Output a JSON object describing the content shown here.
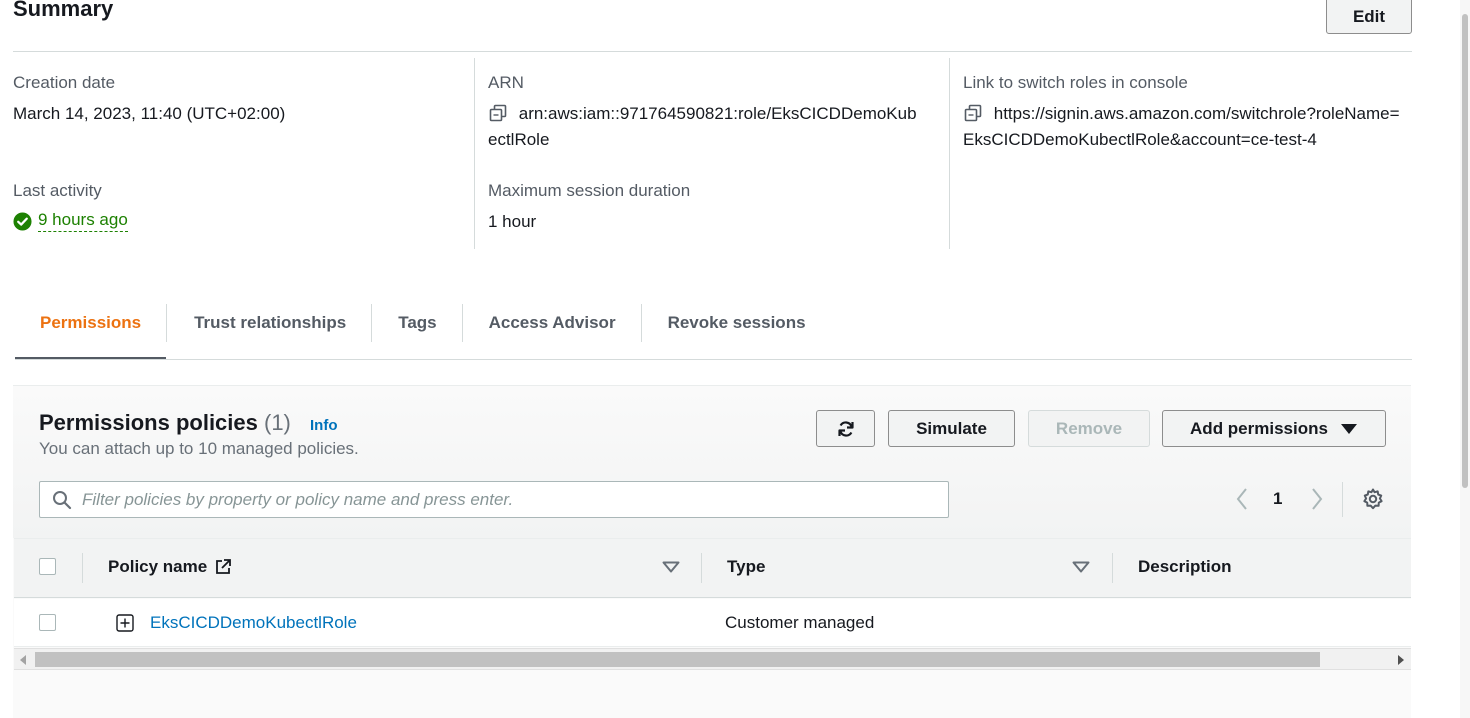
{
  "summary": {
    "title": "Summary",
    "edit_label": "Edit",
    "creation_date_label": "Creation date",
    "creation_date_value": "March 14, 2023, 11:40 (UTC+02:00)",
    "last_activity_label": "Last activity",
    "last_activity_value": "9 hours ago",
    "arn_label": "ARN",
    "arn_line1": "arn:aws:iam::971764590821:role/EksCICDDemoKub",
    "arn_line2": "ectlRole",
    "max_session_label": "Maximum session duration",
    "max_session_value": "1 hour",
    "switch_link_label": "Link to switch roles in console",
    "switch_link_line1": "https://signin.aws.amazon.com/switchrole?roleName=",
    "switch_link_line2": "EksCICDDemoKubectlRole&account=ce-test-4"
  },
  "tabs": [
    {
      "label": "Permissions",
      "active": true
    },
    {
      "label": "Trust relationships"
    },
    {
      "label": "Tags"
    },
    {
      "label": "Access Advisor"
    },
    {
      "label": "Revoke sessions"
    }
  ],
  "policies": {
    "title": "Permissions policies",
    "count": "(1)",
    "info_label": "Info",
    "description": "You can attach up to 10 managed policies.",
    "simulate_label": "Simulate",
    "remove_label": "Remove",
    "add_permissions_label": "Add permissions",
    "search_placeholder": "Filter policies by property or policy name and press enter.",
    "current_page": "1"
  },
  "table": {
    "columns": [
      "Policy name",
      "Type",
      "Description"
    ],
    "rows": [
      {
        "name": "EksCICDDemoKubectlRole",
        "type": "Customer managed",
        "description": ""
      }
    ]
  },
  "colors": {
    "accent_orange": "#ec7211",
    "link_blue": "#0073bb",
    "success_green": "#1d8102"
  }
}
